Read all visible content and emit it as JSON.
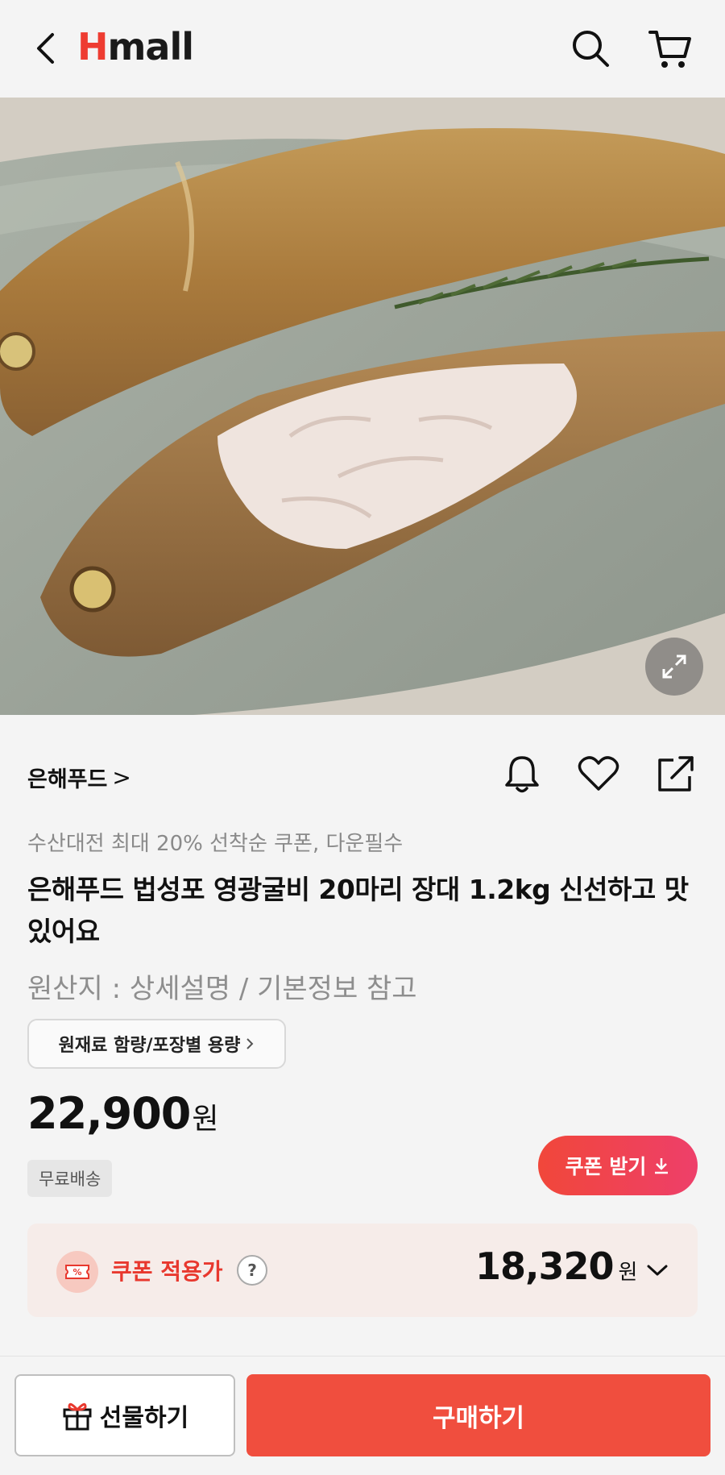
{
  "header": {
    "logo_h": "H",
    "logo_rest": "mall",
    "back_icon": "chevron-left-icon",
    "search_icon": "search-icon",
    "cart_icon": "cart-icon"
  },
  "product": {
    "brand": "은해푸드",
    "brand_chevron": ">",
    "promo": "수산대전 최대 20% 선착순 쿠폰, 다운필수",
    "title": "은해푸드 법성포 영광굴비 20마리 장대 1.2kg 신선하고 맛있어요",
    "origin": "원산지 : 상세설명 / 기본정보 참고",
    "ingredient_button": "원재료 함량/포장별 용량",
    "price": "22,900",
    "price_unit": "원",
    "shipping": "무료배송"
  },
  "coupon": {
    "get_button": "쿠폰 받기",
    "label": "쿠폰 적용가",
    "help": "?",
    "icon_text": "%",
    "price": "18,320",
    "price_unit": "원"
  },
  "bottom": {
    "gift_button": "선물하기",
    "buy_button": "구매하기"
  },
  "colors": {
    "brand_red": "#ee3c31",
    "buy_button": "#f04e3e",
    "coupon_bg": "#f6ece9"
  }
}
